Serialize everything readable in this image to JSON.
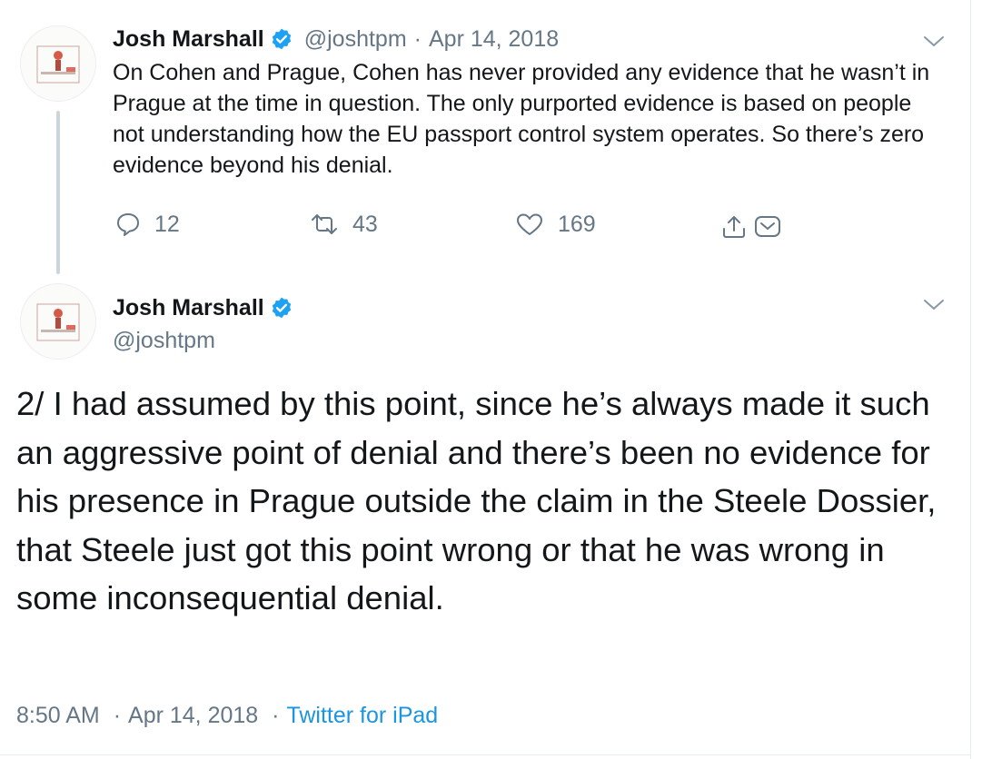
{
  "reply_tweet": {
    "author_name": "Josh Marshall",
    "handle": "@joshtpm",
    "separator": "·",
    "date": "Apr 14, 2018",
    "text": "On Cohen and Prague,  Cohen has never provided any evidence that he wasn’t in Prague at the time in question. The only purported evidence is based on people not understanding how the EU passport control system operates. So there’s zero evidence beyond his denial.",
    "reply_count": "12",
    "retweet_count": "43",
    "like_count": "169"
  },
  "main_tweet": {
    "author_name": "Josh Marshall",
    "handle": "@joshtpm",
    "text": "2/ I had assumed by this point, since he’s always made it such an aggressive point of denial and there’s been no evidence for his presence in Prague outside the claim in the Steele Dossier, that Steele just got this point wrong or that he was wrong in some inconsequential denial.",
    "time": "8:50 AM",
    "separator": "·",
    "date": "Apr 14, 2018",
    "source": "Twitter for iPad"
  },
  "colors": {
    "text": "#14171a",
    "muted": "#657786",
    "link": "#1b95e0",
    "verified": "#1da1f2",
    "thread_line": "#cbd5dc"
  },
  "icons": [
    "verified-badge-icon",
    "chevron-down-icon",
    "reply-icon",
    "retweet-icon",
    "like-heart-icon",
    "share-icon",
    "direct-message-icon"
  ]
}
